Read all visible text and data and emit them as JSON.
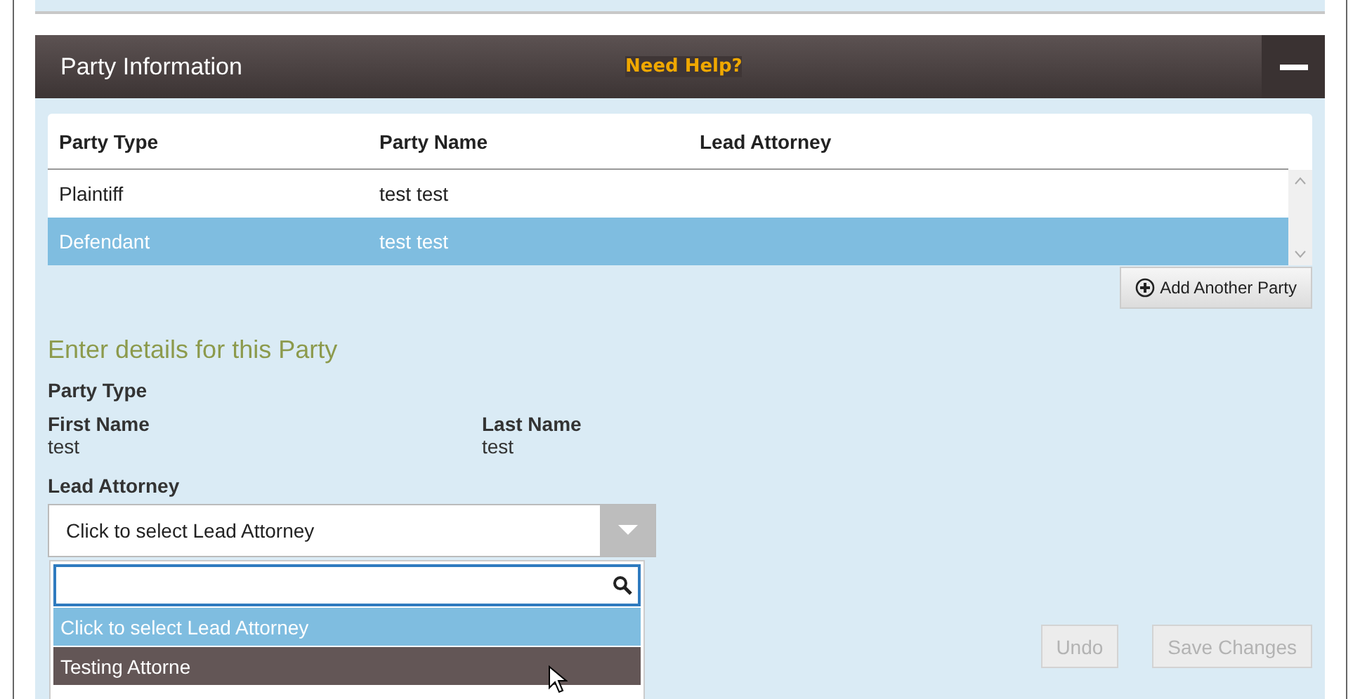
{
  "panel": {
    "title": "Party Information",
    "help_link": "Need Help?",
    "collapsed": false
  },
  "table": {
    "columns": [
      "Party Type",
      "Party Name",
      "Lead Attorney"
    ],
    "rows": [
      {
        "cells": [
          "Plaintiff",
          "test test",
          ""
        ],
        "selected": false
      },
      {
        "cells": [
          "Defendant",
          "test test",
          ""
        ],
        "selected": true
      }
    ]
  },
  "add_button": {
    "label": "Add Another Party"
  },
  "details": {
    "heading": "Enter details for this Party",
    "party_type_label": "Party Type",
    "first_name": {
      "label": "First Name",
      "value": "test"
    },
    "last_name": {
      "label": "Last Name",
      "value": "test"
    },
    "lead_attorney": {
      "label": "Lead Attorney",
      "value": "Click to select Lead Attorney",
      "expanded": true,
      "options": [
        {
          "label": "Click to select Lead Attorney",
          "selected": true,
          "hovered": false
        },
        {
          "label": "Testing Attorne",
          "selected": false,
          "hovered": true
        }
      ]
    }
  },
  "actions": [
    {
      "label": "Undo",
      "disabled": true
    },
    {
      "label": "Save Changes",
      "disabled": true
    }
  ]
}
